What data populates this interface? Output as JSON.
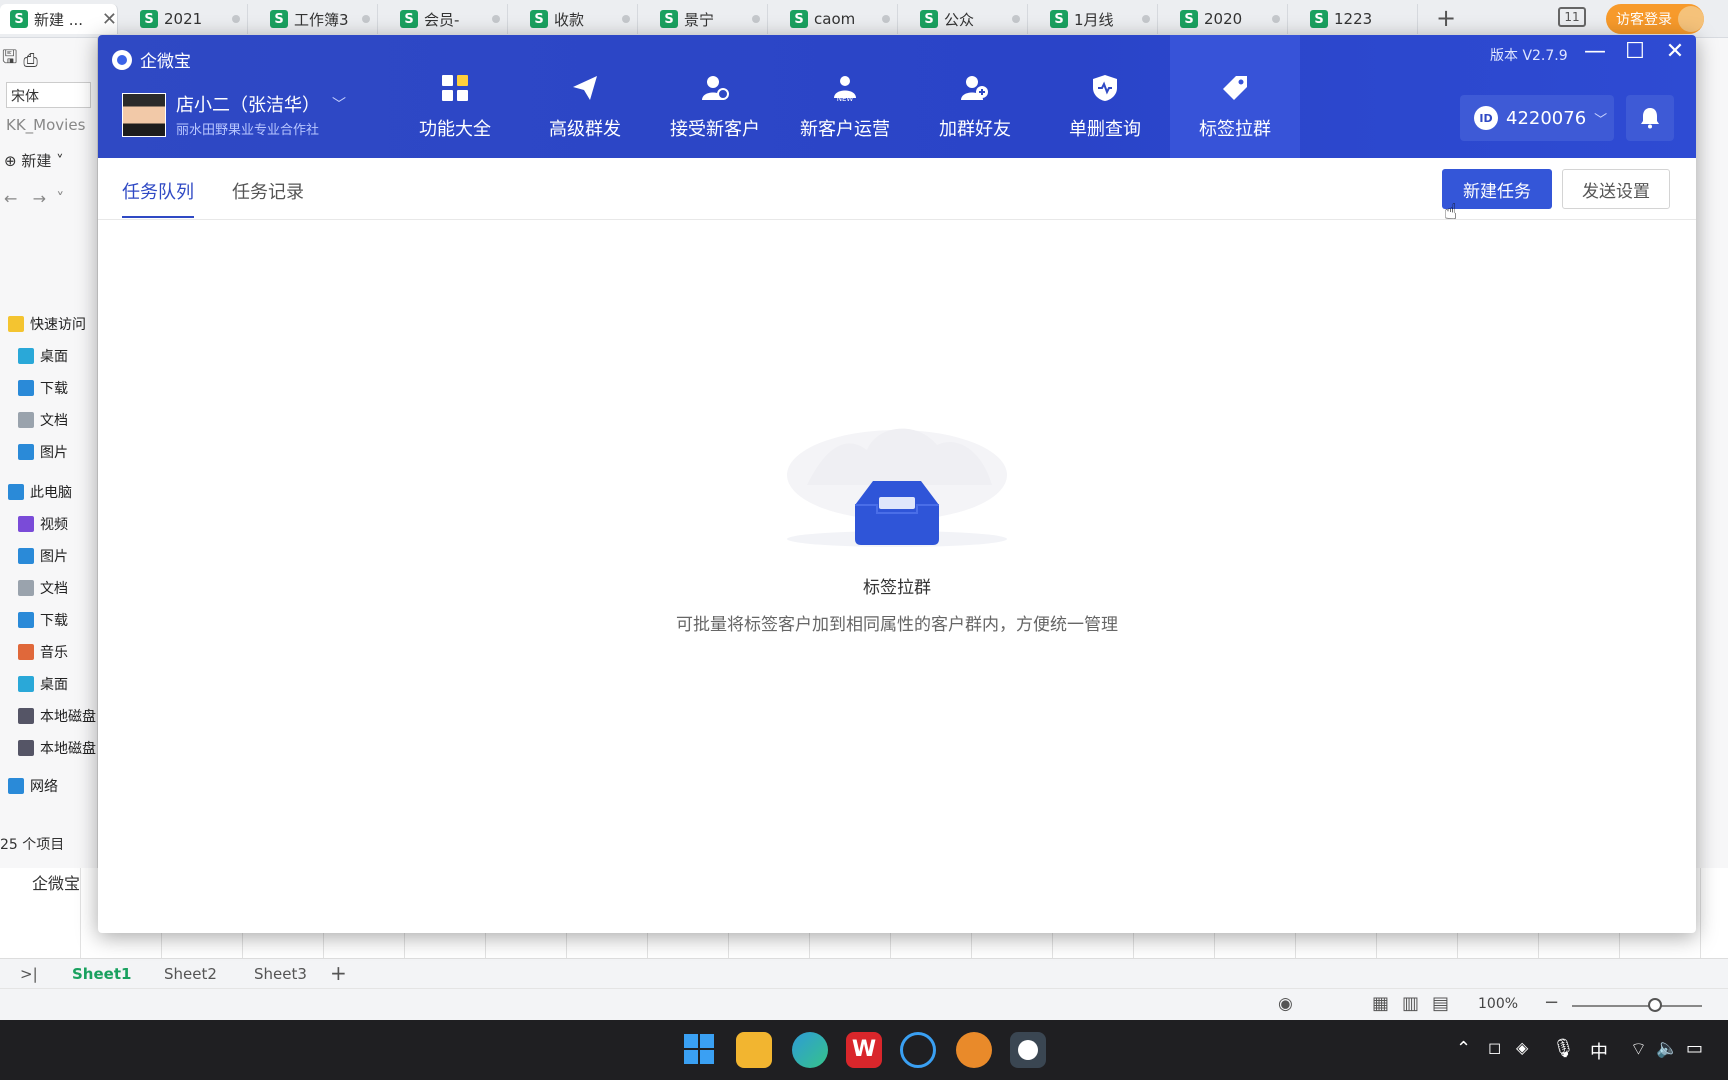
{
  "browser_tabs": [
    {
      "label": "新建 ...",
      "active": true
    },
    {
      "label": "2021"
    },
    {
      "label": "工作簿3"
    },
    {
      "label": "会员-"
    },
    {
      "label": "收款"
    },
    {
      "label": "景宁"
    },
    {
      "label": "caom"
    },
    {
      "label": "公众"
    },
    {
      "label": "1月线"
    },
    {
      "label": "2020"
    },
    {
      "label": "1223"
    }
  ],
  "visitor_login": "访客登录",
  "explorer": {
    "font": "宋体",
    "kk": "KK_Movies",
    "new_label": "新建",
    "items": [
      {
        "label": "快速访问",
        "color": "#f4c430"
      },
      {
        "label": "桌面",
        "color": "#2aa8d8"
      },
      {
        "label": "下载",
        "color": "#2a8ad8"
      },
      {
        "label": "文档",
        "color": "#9aa3ad"
      },
      {
        "label": "图片",
        "color": "#2a8ad8"
      },
      {
        "label": "此电脑",
        "color": "#2a8ad8"
      },
      {
        "label": "视频",
        "color": "#7a4bd8"
      },
      {
        "label": "图片",
        "color": "#2a8ad8"
      },
      {
        "label": "文档",
        "color": "#9aa3ad"
      },
      {
        "label": "下载",
        "color": "#2a8ad8"
      },
      {
        "label": "音乐",
        "color": "#e0683a"
      },
      {
        "label": "桌面",
        "color": "#2aa8d8"
      },
      {
        "label": "本地磁盘",
        "color": "#556"
      },
      {
        "label": "本地磁盘",
        "color": "#556"
      },
      {
        "label": "网络",
        "color": "#2a8ad8"
      }
    ],
    "count": "25 个项目"
  },
  "sheet": {
    "cell_text": "企微宝",
    "tabs": [
      "Sheet1",
      "Sheet2",
      "Sheet3"
    ],
    "zoom": "100%"
  },
  "app": {
    "title": "企微宝",
    "version": "版本 V2.7.9",
    "user": {
      "name": "店小二（张洁华）",
      "org": "丽水田野果业专业合作社"
    },
    "nav": [
      {
        "label": "功能大全",
        "icon": "grid-icon"
      },
      {
        "label": "高级群发",
        "icon": "send-icon"
      },
      {
        "label": "接受新客户",
        "icon": "user-check-icon"
      },
      {
        "label": "新客户运营",
        "icon": "new-user-icon"
      },
      {
        "label": "加群好友",
        "icon": "add-friend-icon"
      },
      {
        "label": "单删查询",
        "icon": "shield-icon"
      },
      {
        "label": "标签拉群",
        "icon": "tag-icon",
        "active": true
      }
    ],
    "id_value": "4220076",
    "id_badge": "ID",
    "subtabs": [
      "任务队列",
      "任务记录"
    ],
    "new_task": "新建任务",
    "send_settings": "发送设置",
    "empty": {
      "title": "标签拉群",
      "desc": "可批量将标签客户加到相同属性的客户群内，方便统一管理"
    }
  },
  "taskbar": {
    "ime": "中"
  },
  "colors": {
    "brand": "#2f49c4",
    "primary_button": "#3456d8",
    "sheet_accent": "#19a15f"
  }
}
